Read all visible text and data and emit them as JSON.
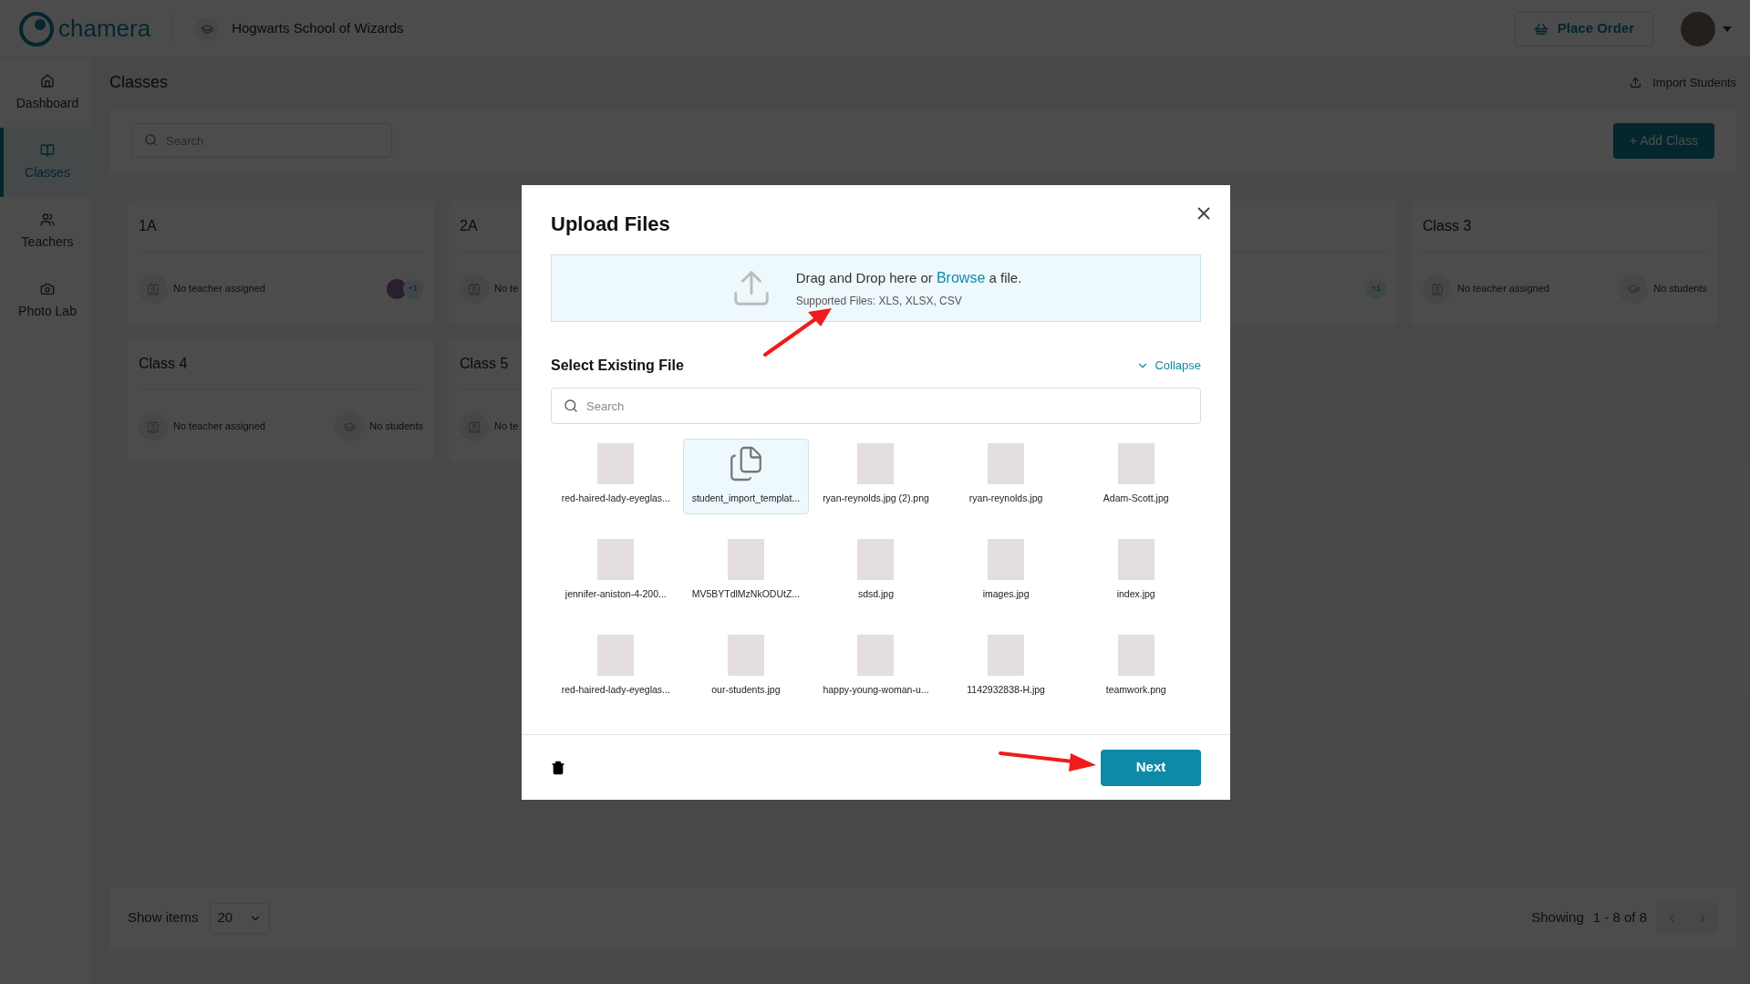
{
  "header": {
    "logo": "chamera",
    "school": "Hogwarts School of Wizards",
    "place_order": "Place Order"
  },
  "sidebar": {
    "items": [
      {
        "label": "Dashboard",
        "selected": false
      },
      {
        "label": "Classes",
        "selected": true
      },
      {
        "label": "Teachers",
        "selected": false
      },
      {
        "label": "Photo Lab",
        "selected": false
      }
    ]
  },
  "page": {
    "title": "Classes",
    "import_students": "Import Students",
    "search_placeholder": "Search",
    "add_class": "+ Add Class"
  },
  "classes": [
    {
      "name": "1A",
      "teacher": "No teacher assigned",
      "student_photo": true,
      "extra": "+1"
    },
    {
      "name": "2A",
      "teacher": "No te"
    },
    {
      "extra": "+1"
    },
    {
      "name": "Class 3",
      "teacher": "No teacher assigned",
      "students": "No students"
    },
    {
      "name": "Class 4",
      "teacher": "No teacher assigned",
      "students": "No students"
    },
    {
      "name": "Class 5",
      "teacher": "No te"
    }
  ],
  "footer": {
    "show_items": "Show items",
    "page_size": "20",
    "showing": "Showing",
    "range": "1 - 8 of 8"
  },
  "modal": {
    "title": "Upload Files",
    "drop_before": "Drag and Drop here or",
    "browse": "Browse",
    "drop_after": "a file.",
    "supported": "Supported Files: XLS, XLSX, CSV",
    "section": "Select Existing File",
    "collapse": "Collapse",
    "search_placeholder": "Search",
    "next": "Next",
    "files": [
      {
        "name": "red-haired-lady-eyeglas...",
        "kind": "image",
        "selected": false
      },
      {
        "name": "student_import_templat...",
        "kind": "document",
        "selected": true
      },
      {
        "name": "ryan-reynolds.jpg (2).png",
        "kind": "image",
        "selected": false
      },
      {
        "name": "ryan-reynolds.jpg",
        "kind": "image",
        "selected": false
      },
      {
        "name": "Adam-Scott.jpg",
        "kind": "image",
        "selected": false
      },
      {
        "name": "jennifer-aniston-4-200...",
        "kind": "image",
        "selected": false
      },
      {
        "name": "MV5BYTdlMzNkODUtZ...",
        "kind": "image",
        "selected": false
      },
      {
        "name": "sdsd.jpg",
        "kind": "image",
        "selected": false
      },
      {
        "name": "images.jpg",
        "kind": "image",
        "selected": false
      },
      {
        "name": "index.jpg",
        "kind": "image",
        "selected": false
      },
      {
        "name": "red-haired-lady-eyeglas...",
        "kind": "image",
        "selected": false
      },
      {
        "name": "our-students.jpg",
        "kind": "image",
        "selected": false
      },
      {
        "name": "happy-young-woman-u...",
        "kind": "image",
        "selected": false
      },
      {
        "name": "1142932838-H.jpg",
        "kind": "image",
        "selected": false
      },
      {
        "name": "teamwork.png",
        "kind": "image",
        "selected": false
      }
    ]
  }
}
